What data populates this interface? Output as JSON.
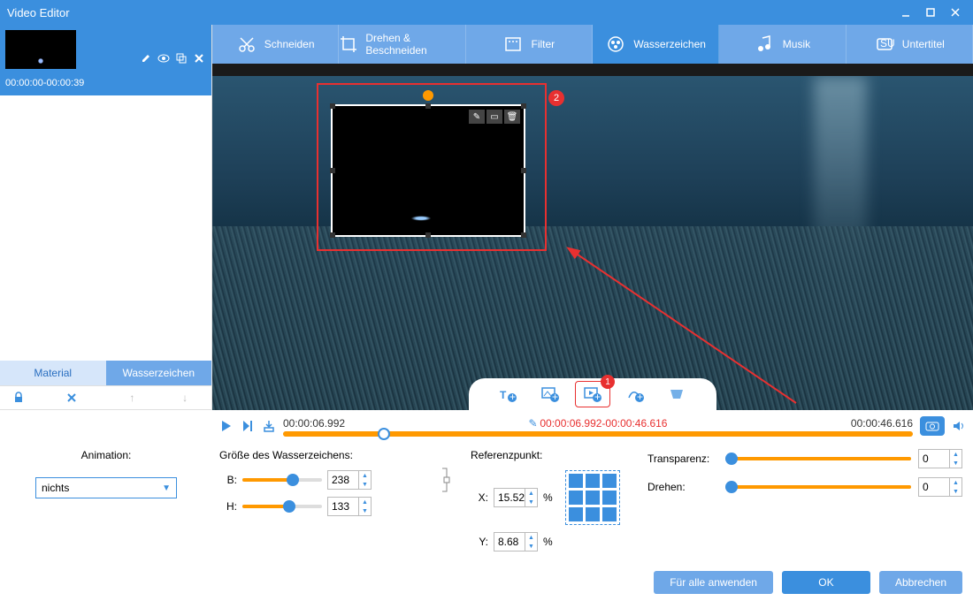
{
  "window": {
    "title": "Video Editor"
  },
  "clip": {
    "range": "00:00:00-00:00:39"
  },
  "sidebar": {
    "tabs": {
      "material": "Material",
      "watermark": "Wasserzeichen"
    }
  },
  "toolbar": {
    "cut": "Schneiden",
    "rotate": "Drehen & Beschneiden",
    "filter": "Filter",
    "watermark": "Wasserzeichen",
    "music": "Musik",
    "subtitle": "Untertitel"
  },
  "annotations": {
    "badge1": "1",
    "badge2": "2"
  },
  "timeline": {
    "start": "00:00:06.992",
    "mid": "00:00:06.992-00:00:46.616",
    "end": "00:00:46.616",
    "progress_pct": 15
  },
  "props": {
    "animation_label": "Animation:",
    "animation_value": "nichts",
    "size_title": "Größe des Wasserzeichens:",
    "width_label": "B:",
    "width_value": "238",
    "width_pct": 60,
    "height_label": "H:",
    "height_value": "133",
    "height_pct": 55,
    "ref_title": "Referenzpunkt:",
    "x_label": "X:",
    "x_value": "15.52",
    "y_label": "Y:",
    "y_value": "8.68",
    "pct": "%",
    "transparency_label": "Transparenz:",
    "transparency_value": "0",
    "rotate_label": "Drehen:",
    "rotate_value": "0"
  },
  "buttons": {
    "apply_all": "Für alle anwenden",
    "ok": "OK",
    "cancel": "Abbrechen"
  }
}
